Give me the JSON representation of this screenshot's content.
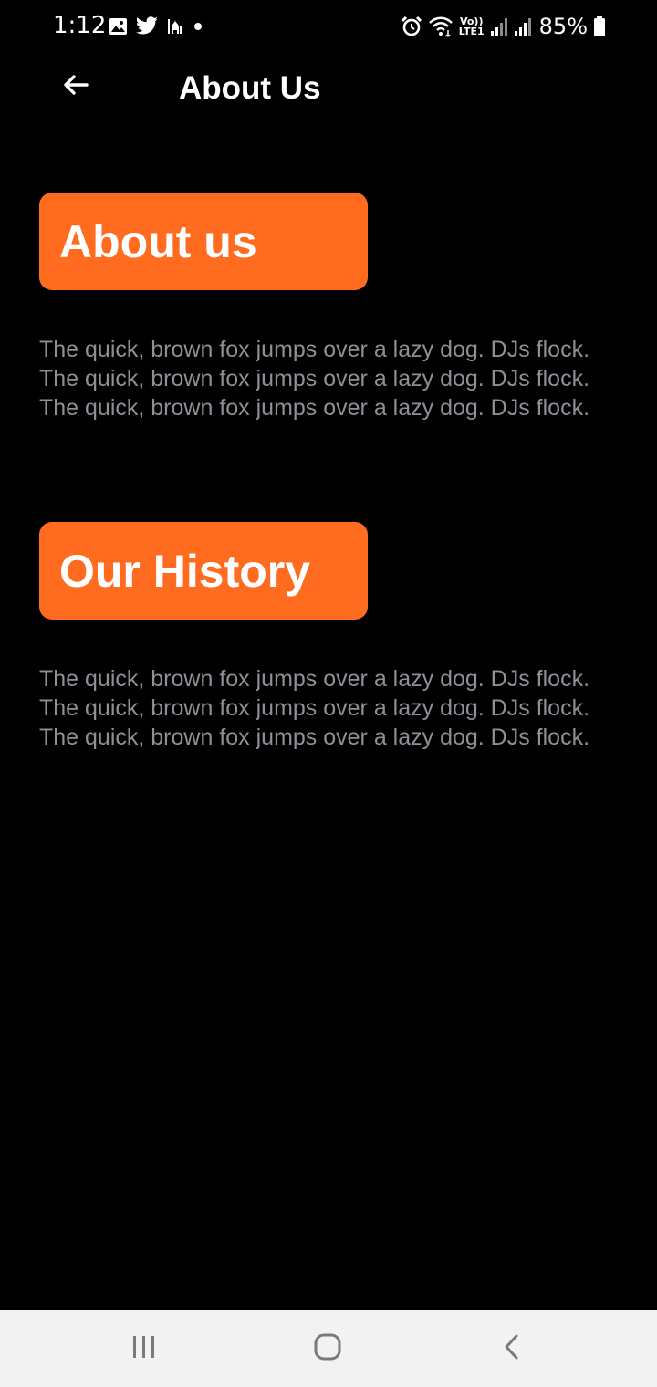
{
  "status_bar": {
    "time": "1:12",
    "battery": "85%",
    "left_icons": [
      "gallery-icon",
      "twitter-icon",
      "mosque-icon",
      "dot-icon"
    ],
    "right_icons": [
      "alarm-icon",
      "wifi-icon",
      "volte-lte-icon",
      "signal-icon",
      "signal-icon",
      "battery-icon"
    ],
    "volte_label_top": "Vo))",
    "volte_label_bottom": "LTE1"
  },
  "app_bar": {
    "title": "About Us",
    "back_icon": "arrow-left-icon"
  },
  "sections": [
    {
      "heading": "About us",
      "body": "The quick, brown fox jumps over a lazy dog. DJs flock. The quick, brown fox jumps over a lazy dog. DJs flock. The quick, brown fox jumps over a lazy dog. DJs flock."
    },
    {
      "heading": "Our History",
      "body": "The quick, brown fox jumps over a lazy dog. DJs flock. The quick, brown fox jumps over a lazy dog. DJs flock. The quick, brown fox jumps over a lazy dog. DJs flock."
    }
  ],
  "nav_bar": {
    "icons": [
      "recents-icon",
      "home-icon",
      "back-icon"
    ]
  },
  "colors": {
    "background": "#000000",
    "accent": "#ff6b1f",
    "heading_text": "#ffffff",
    "body_text": "#8d9096",
    "nav_bar": "#f2f2f2"
  }
}
